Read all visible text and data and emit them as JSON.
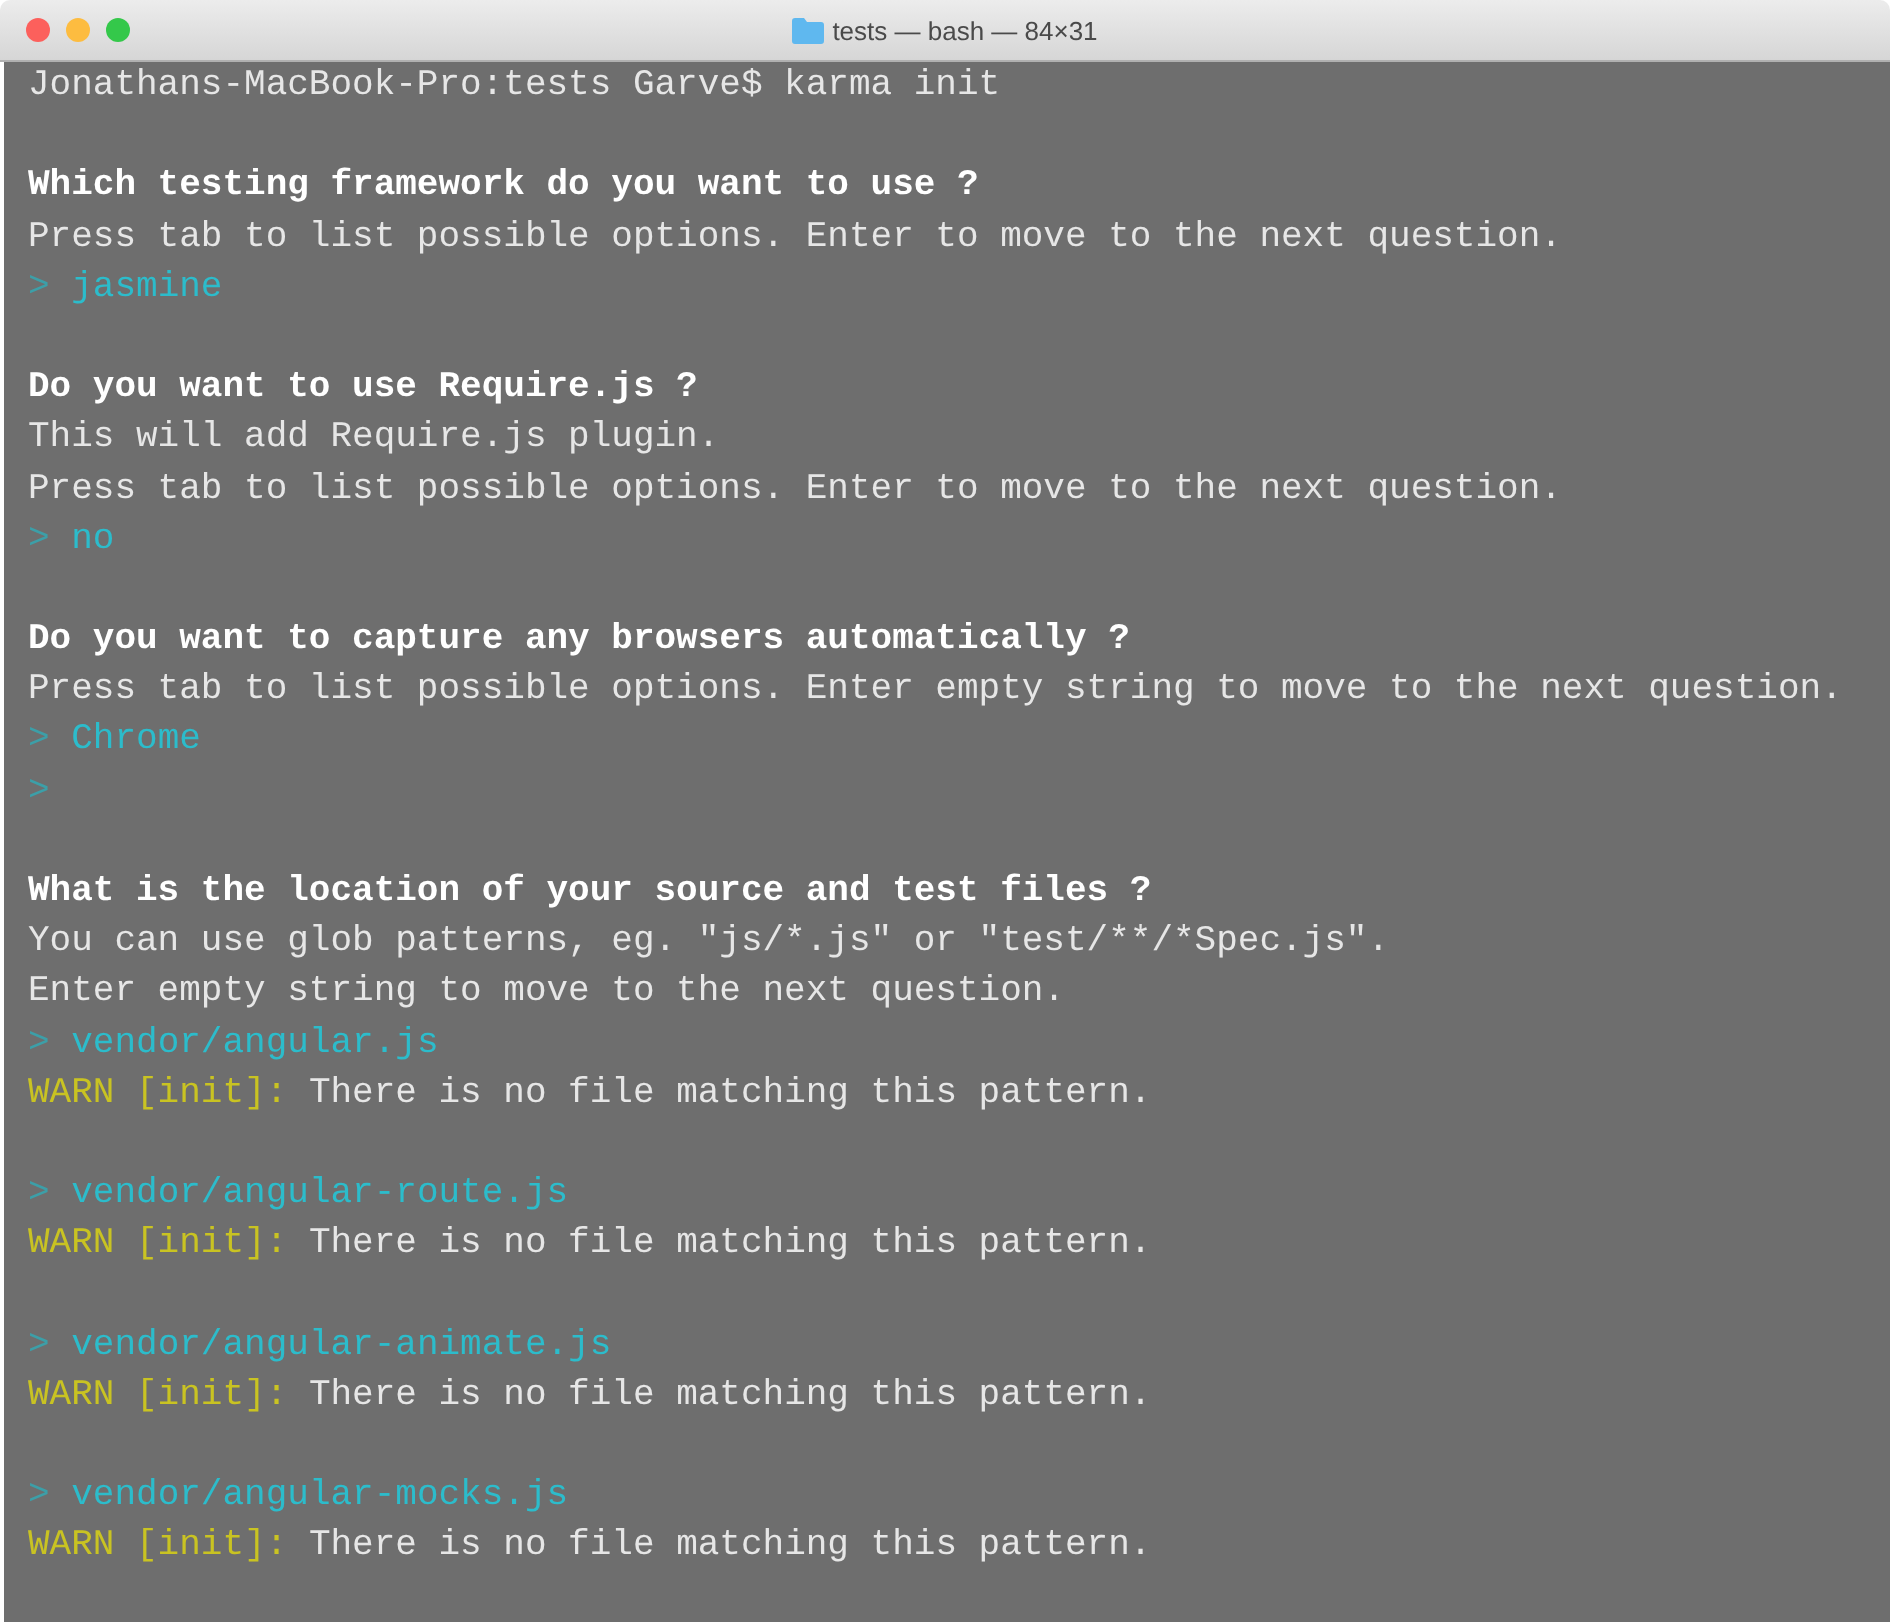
{
  "window": {
    "title": "tests — bash — 84×31"
  },
  "lines": [
    {
      "kind": "command",
      "text": "Jonathans-MacBook-Pro:tests Garve$ karma init"
    },
    {
      "kind": "blank"
    },
    {
      "kind": "question",
      "text": "Which testing framework do you want to use ?"
    },
    {
      "kind": "info",
      "text": "Press tab to list possible options. Enter to move to the next question."
    },
    {
      "kind": "answer",
      "marker": ">",
      "text": "jasmine"
    },
    {
      "kind": "blank"
    },
    {
      "kind": "question",
      "text": "Do you want to use Require.js ?"
    },
    {
      "kind": "info",
      "text": "This will add Require.js plugin."
    },
    {
      "kind": "info",
      "text": "Press tab to list possible options. Enter to move to the next question."
    },
    {
      "kind": "answer",
      "marker": ">",
      "text": "no"
    },
    {
      "kind": "blank"
    },
    {
      "kind": "question",
      "text": "Do you want to capture any browsers automatically ?"
    },
    {
      "kind": "info",
      "text": "Press tab to list possible options. Enter empty string to move to the next question."
    },
    {
      "kind": "answer",
      "marker": ">",
      "text": "Chrome"
    },
    {
      "kind": "answer",
      "marker": ">"
    },
    {
      "kind": "blank"
    },
    {
      "kind": "question",
      "text": "What is the location of your source and test files ?"
    },
    {
      "kind": "info",
      "text": "You can use glob patterns, eg. \"js/*.js\" or \"test/**/*Spec.js\"."
    },
    {
      "kind": "info",
      "text": "Enter empty string to move to the next question."
    },
    {
      "kind": "answer",
      "marker": ">",
      "text": "vendor/angular.js"
    },
    {
      "kind": "warn",
      "label": "WARN [init]:",
      "text": "There is no file matching this pattern."
    },
    {
      "kind": "blank"
    },
    {
      "kind": "answer",
      "marker": ">",
      "text": "vendor/angular-route.js"
    },
    {
      "kind": "warn",
      "label": "WARN [init]:",
      "text": "There is no file matching this pattern."
    },
    {
      "kind": "blank"
    },
    {
      "kind": "answer",
      "marker": ">",
      "text": "vendor/angular-animate.js"
    },
    {
      "kind": "warn",
      "label": "WARN [init]:",
      "text": "There is no file matching this pattern."
    },
    {
      "kind": "blank"
    },
    {
      "kind": "answer",
      "marker": ">",
      "text": "vendor/angular-mocks.js"
    },
    {
      "kind": "warn",
      "label": "WARN [init]:",
      "text": "There is no file matching this pattern."
    },
    {
      "kind": "blank"
    }
  ]
}
